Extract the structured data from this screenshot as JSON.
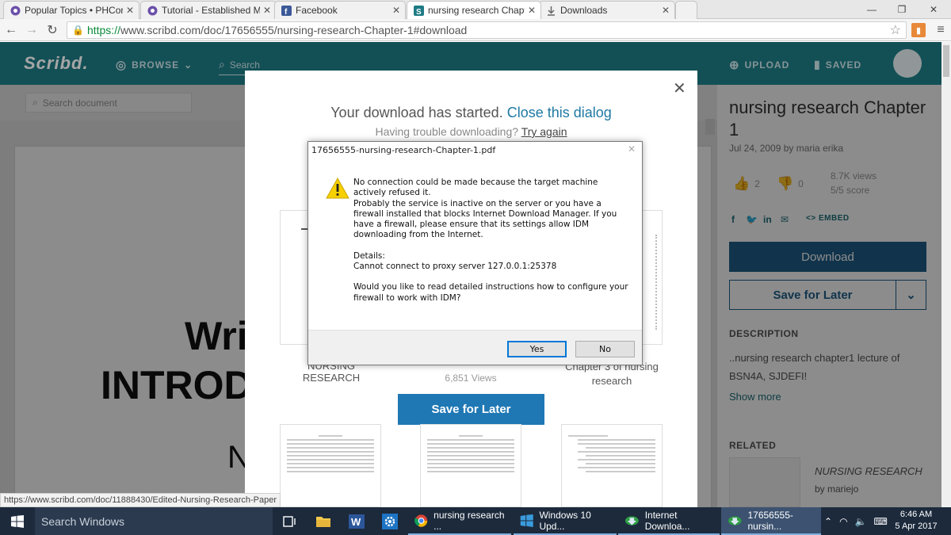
{
  "browser": {
    "tabs": [
      {
        "title": "Popular Topics • PHCorne",
        "active": false
      },
      {
        "title": "Tutorial - Established Men",
        "active": false
      },
      {
        "title": "Facebook",
        "active": false
      },
      {
        "title": "nursing research Chapter",
        "active": true
      },
      {
        "title": "Downloads",
        "active": false
      }
    ],
    "url_scheme": "https://",
    "url_rest": "www.scribd.com/doc/17656555/nursing-research-Chapter-1#download",
    "status_url": "https://www.scribd.com/doc/11888430/Edited-Nursing-Research-Paper"
  },
  "scribd": {
    "logo": "Scribd.",
    "browse": "BROWSE",
    "search": "Search",
    "upload": "UPLOAD",
    "saved": "SAVED",
    "doc_search_placeholder": "Search document",
    "doc_text": {
      "line1": "Wri",
      "line2": "INTROD",
      "line3": "N"
    }
  },
  "sidebar": {
    "title": "nursing research Chapter 1",
    "meta": "Jul 24, 2009 by maria erika",
    "likes": "2",
    "dislikes": "0",
    "views": "8.7K views",
    "score": "5/5 score",
    "embed": "EMBED",
    "download": "Download",
    "save_for_later": "Save for Later",
    "description_label": "DESCRIPTION",
    "description": "..nursing research chapter1 lecture of BSN4A, SJDEFI!",
    "show_more": "Show more",
    "related_label": "RELATED",
    "related_title": "NURSING RESEARCH",
    "related_by": "by mariejo"
  },
  "modal": {
    "started": "Your download has started.",
    "close_link": "Close this dialog",
    "trouble": "Having trouble downloading?",
    "try_again": "Try again",
    "thumb1_label": "NURSING RESEARCH",
    "thumb3_label": "Chapter 3 of nursing research",
    "views": "6,851 Views",
    "save_for_later": "Save for Later"
  },
  "idm": {
    "title": "17656555-nursing-research-Chapter-1.pdf",
    "p1": "No connection could be made because the target machine actively refused it.",
    "p2": "Probably the service is inactive on the server or you have a firewall installed that blocks Internet Download Manager. If you have a firewall, please ensure that its settings allow IDM downloading from the Internet.",
    "details_label": "Details:",
    "details": "Cannot connect to proxy server 127.0.0.1:25378",
    "question": "Would you like to read detailed instructions how to configure your firewall to work with IDM?",
    "yes": "Yes",
    "no": "No"
  },
  "taskbar": {
    "search": "Search Windows",
    "apps": [
      "nursing research ...",
      "Windows 10 Upd...",
      "Internet Downloa...",
      "17656555-nursin..."
    ],
    "time": "6:46 AM",
    "date": "5 Apr 2017"
  },
  "colors": {
    "scribd_teal": "#1e7b85",
    "download_blue": "#1f5f8b",
    "taskbar": "#1c2a3c"
  }
}
